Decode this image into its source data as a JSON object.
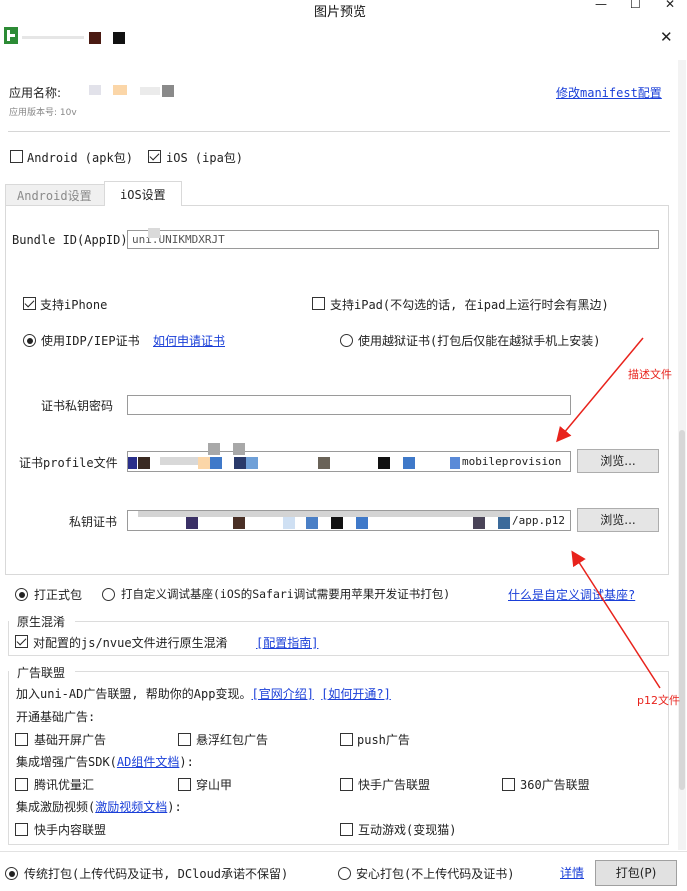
{
  "window": {
    "title": "图片预览",
    "controls": {
      "minimize": "—",
      "maximize": "☐",
      "close": "✕"
    },
    "inner_close": "✕"
  },
  "app": {
    "name_label": "应用名称:",
    "version_label": "应用版本号: 10v",
    "manifest_link": "修改manifest配置"
  },
  "platforms": {
    "android": {
      "label": "Android (apk包)",
      "checked": false
    },
    "ios": {
      "label": "iOS (ipa包)",
      "checked": true
    }
  },
  "tabs": [
    {
      "label": "Android设置",
      "active": false
    },
    {
      "label": "iOS设置",
      "active": true
    }
  ],
  "ios": {
    "bundle_label": "Bundle ID(AppID)",
    "bundle_value": "uni.UNIKMDXRJT",
    "support_iphone": {
      "label": "支持iPhone",
      "checked": true
    },
    "support_ipad": {
      "label": "支持iPad(不勾选的话, 在ipad上运行时会有黑边)",
      "checked": false
    },
    "cert_idp": {
      "label": "使用IDP/IEP证书",
      "selected": true
    },
    "cert_link": "如何申请证书",
    "cert_jailbreak": {
      "label": "使用越狱证书(打包后仅能在越狱手机上安装)",
      "selected": false
    },
    "key_password_label": "证书私钥密码",
    "key_password_value": "",
    "profile_label": "证书profile文件",
    "profile_value": "mobileprovision",
    "p12_label": "私钥证书",
    "p12_value": "/app.p12",
    "browse_label": "浏览..."
  },
  "annotations": {
    "profile_note": "描述文件",
    "p12_note": "p12文件",
    "arrow_color": "#e8231c"
  },
  "build_type": {
    "formal": {
      "label": "打正式包",
      "selected": true
    },
    "custom": {
      "label": "打自定义调试基座(iOS的Safari调试需要用苹果开发证书打包)",
      "selected": false
    },
    "custom_link": "什么是自定义调试基座?"
  },
  "obfuscation": {
    "title": "原生混淆",
    "option": {
      "label": "对配置的js/nvue文件进行原生混淆",
      "checked": true
    },
    "guide_link": "[配置指南]"
  },
  "ads": {
    "title": "广告联盟",
    "intro": "加入uni-AD广告联盟, 帮助你的App变现。",
    "intro_links": [
      "[官网介绍]",
      "[如何开通?]"
    ],
    "basic_label": "开通基础广告:",
    "basic": [
      {
        "label": "基础开屏广告",
        "checked": false
      },
      {
        "label": "悬浮红包广告",
        "checked": false
      },
      {
        "label": "push广告",
        "checked": false
      }
    ],
    "enhanced_prefix": "集成增强广告SDK(",
    "enhanced_link": "AD组件文档",
    "enhanced_suffix": "):",
    "enhanced": [
      {
        "label": "腾讯优量汇",
        "checked": false
      },
      {
        "label": "穿山甲",
        "checked": false
      },
      {
        "label": "快手广告联盟",
        "checked": false
      },
      {
        "label": "360广告联盟",
        "checked": false
      }
    ],
    "reward_prefix": "集成激励视频(",
    "reward_link": "激励视频文档",
    "reward_suffix": "):",
    "reward": [
      {
        "label": "快手内容联盟",
        "checked": false
      },
      {
        "label": "互动游戏(变现猫)",
        "checked": false
      }
    ]
  },
  "footer": {
    "traditional": {
      "label": "传统打包(上传代码及证书, DCloud承诺不保留)",
      "selected": true
    },
    "safe": {
      "label": "安心打包(不上传代码及证书)",
      "selected": false
    },
    "details_link": "详情",
    "pack_button": "打包(P)"
  }
}
